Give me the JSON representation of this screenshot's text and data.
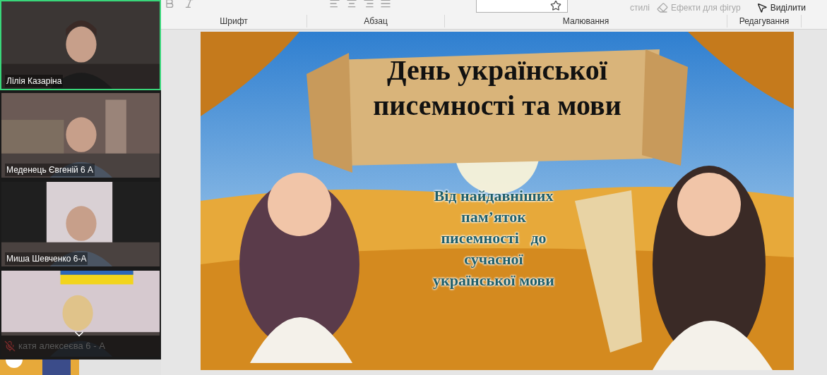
{
  "video_tiles": [
    {
      "name": "Лілія Казаріна",
      "selected": true,
      "muted": false
    },
    {
      "name": "Меденець Євгеній 6 А",
      "selected": false,
      "muted": false
    },
    {
      "name": "Миша Шевченко 6-А",
      "selected": false,
      "muted": false
    },
    {
      "name": "катя алексеєва 6 - А",
      "selected": false,
      "muted": true
    }
  ],
  "ribbon": {
    "groups": [
      {
        "label": "Шрифт"
      },
      {
        "label": "Абзац"
      },
      {
        "label": "Малювання"
      },
      {
        "label": "Редагування"
      }
    ],
    "buttons": [
      {
        "label": "стилі",
        "disabled": true
      },
      {
        "label": "Ефекти для фігур",
        "disabled": true
      },
      {
        "label": "Виділити",
        "disabled": false
      }
    ]
  },
  "slide": {
    "title_lines": [
      "День української",
      "писемності та мови"
    ],
    "subtitle_lines": [
      "Від найдавніших",
      "пам’яток",
      "писемності   до",
      "сучасної",
      "української мови"
    ]
  }
}
